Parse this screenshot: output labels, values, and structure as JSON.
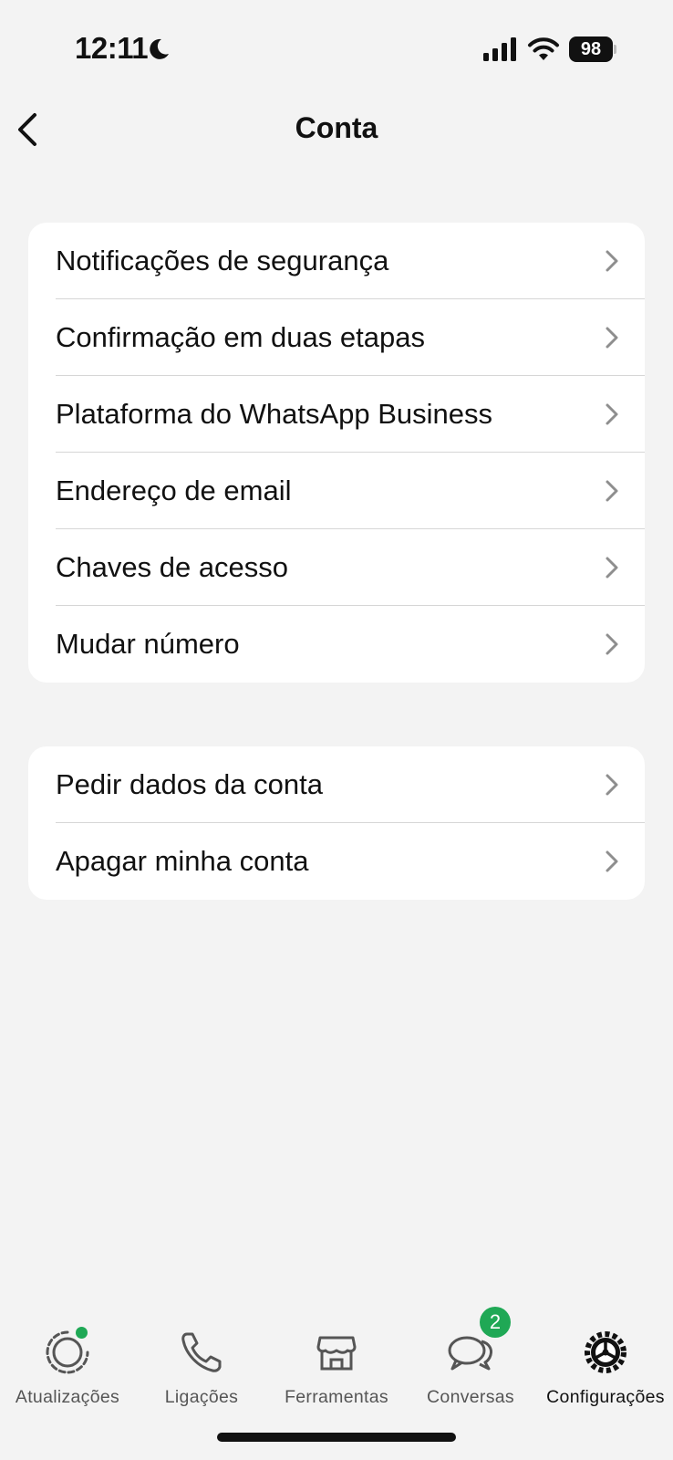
{
  "status_bar": {
    "time": "12:11",
    "battery": "98"
  },
  "header": {
    "title": "Conta"
  },
  "groups": [
    {
      "items": [
        {
          "label": "Notificações de segurança"
        },
        {
          "label": "Confirmação em duas etapas"
        },
        {
          "label": "Plataforma do WhatsApp Business"
        },
        {
          "label": "Endereço de email"
        },
        {
          "label": "Chaves de acesso"
        },
        {
          "label": "Mudar número"
        }
      ]
    },
    {
      "items": [
        {
          "label": "Pedir dados da conta"
        },
        {
          "label": "Apagar minha conta"
        }
      ]
    }
  ],
  "tab_bar": {
    "tabs": [
      {
        "label": "Atualizações",
        "icon": "updates-icon"
      },
      {
        "label": "Ligações",
        "icon": "phone-icon"
      },
      {
        "label": "Ferramentas",
        "icon": "store-icon"
      },
      {
        "label": "Conversas",
        "icon": "chats-icon",
        "badge": "2"
      },
      {
        "label": "Configurações",
        "icon": "gear-icon",
        "active": true
      }
    ]
  },
  "colors": {
    "background": "#f3f3f3",
    "card": "#ffffff",
    "accent_green": "#1fa855"
  }
}
